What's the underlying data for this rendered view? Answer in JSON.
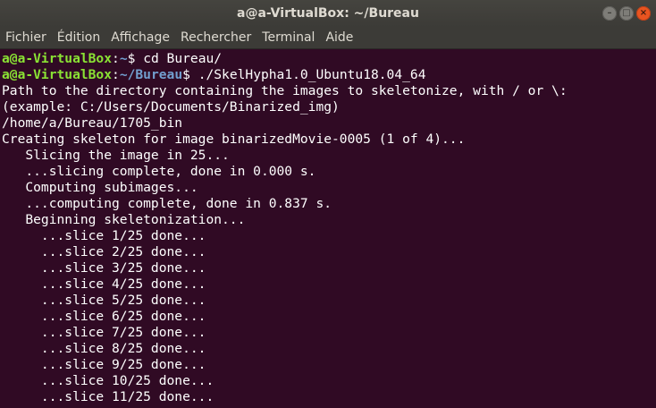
{
  "window": {
    "title": "a@a-VirtualBox: ~/Bureau",
    "buttons": {
      "minimize": "–",
      "maximize": "□",
      "close": "×"
    }
  },
  "menu": [
    "Fichier",
    "Édition",
    "Affichage",
    "Rechercher",
    "Terminal",
    "Aide"
  ],
  "terminal": {
    "prompts": [
      {
        "user": "a@a-VirtualBox",
        "sep": ":",
        "path": "~",
        "symbol": "$ ",
        "command": "cd Bureau/"
      },
      {
        "user": "a@a-VirtualBox",
        "sep": ":",
        "path": "~/Bureau",
        "symbol": "$ ",
        "command": "./SkelHypha1.0_Ubuntu18.04_64"
      }
    ],
    "output": [
      "Path to the directory containing the images to skeletonize, with / or \\:",
      "(example: C:/Users/Documents/Binarized_img)",
      "/home/a/Bureau/1705_bin",
      "Creating skeleton for image binarizedMovie-0005 (1 of 4)...",
      "   Slicing the image in 25...",
      "   ...slicing complete, done in 0.000 s.",
      "   Computing subimages...",
      "   ...computing complete, done in 0.837 s.",
      "   Beginning skeletonization...",
      "     ...slice 1/25 done...",
      "     ...slice 2/25 done...",
      "     ...slice 3/25 done...",
      "     ...slice 4/25 done...",
      "     ...slice 5/25 done...",
      "     ...slice 6/25 done...",
      "     ...slice 7/25 done...",
      "     ...slice 8/25 done...",
      "     ...slice 9/25 done...",
      "     ...slice 10/25 done...",
      "     ...slice 11/25 done..."
    ]
  }
}
